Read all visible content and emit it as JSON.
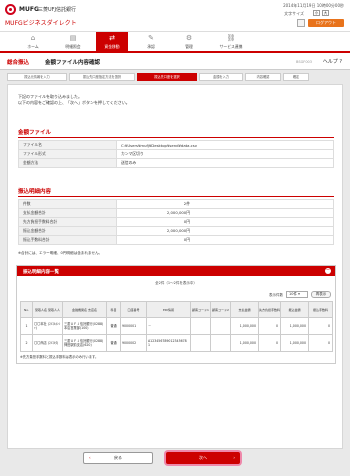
{
  "header": {
    "brand": "MUFG",
    "bank": "三菱UFJ信託銀行",
    "service": "MUFGビジネスダイレクト",
    "datetime": "2014年11月19日 10時00分00秒",
    "font_size_label": "文字サイズ",
    "font_small": "小",
    "font_large": "大",
    "logout": "ログアウト"
  },
  "gnav": [
    {
      "label": "ホーム",
      "icon": "home-icon",
      "glyph": "⌂"
    },
    {
      "label": "明細照会",
      "icon": "document-icon",
      "glyph": "▤"
    },
    {
      "label": "資金移動",
      "icon": "transfer-icon",
      "glyph": "⇄",
      "active": true
    },
    {
      "label": "承認",
      "icon": "approve-icon",
      "glyph": "✎"
    },
    {
      "label": "管理",
      "icon": "admin-icon",
      "glyph": "⚙"
    },
    {
      "label": "サービス連携",
      "icon": "link-icon",
      "glyph": "⛓"
    }
  ],
  "titlebar": {
    "category": "総合振込",
    "title": "金額ファイル内容確認",
    "page_id": "BSGF003",
    "help": "ヘルプ"
  },
  "steps": [
    "振込元情報を入力",
    "振込先口座指定方法を選択",
    "振込先口座を選択",
    "金額を入力",
    "内容確認",
    "確定"
  ],
  "active_step": 2,
  "message": [
    "下記のファイルを取り込みました。",
    "以下の内容をご確認の上、「次へ」ボタンを押してください。"
  ],
  "file_section": {
    "title": "金額ファイル",
    "rows": [
      {
        "k": "ファイル名",
        "v": "C:¥Users¥mufj¥Desktop¥send¥data.csv"
      },
      {
        "k": "ファイル形式",
        "v": "カンマ区切り"
      },
      {
        "k": "金額方法",
        "v": "送信のみ"
      }
    ]
  },
  "summary_section": {
    "title": "振込明細内容",
    "rows": [
      {
        "k": "件数",
        "v": "2件"
      },
      {
        "k": "支払金額合計",
        "v": "2,000,000円"
      },
      {
        "k": "先方負担手数料合計",
        "v": "0円"
      },
      {
        "k": "振込金額合計",
        "v": "2,000,000円"
      },
      {
        "k": "振込手数料合計",
        "v": "0円"
      }
    ],
    "note": "※合計には、エラー明細、0円明細は含まれません。"
  },
  "list": {
    "title": "振込明細内容一覧",
    "count": "全2件（1〜2件を表示中）",
    "perpage_label": "表示件数",
    "perpage_value": "10件",
    "redisplay": "再表示",
    "headers": [
      "No.",
      "受取人名 受取人人",
      "金融機関名 支店名",
      "科目",
      "口座番号",
      "EDI情報",
      "顧客コード1",
      "顧客コード2",
      "支払金額",
      "先方負担手数料",
      "振込金額",
      "振込手数料"
    ],
    "rows": [
      [
        "1",
        "〇〇本社 (ﾏﾙﾏﾙﾎﾝｼｬ)",
        "三菱ＵＦＪ信託銀行(0288) 本店営業部(100)",
        "普通",
        "9000001",
        "－",
        "",
        "",
        "1,000,000",
        "0",
        "1,000,000",
        "0"
      ],
      [
        "2",
        "〇〇商店 (ﾏﾙﾏﾙﾀ)",
        "三菱ＵＦＪ信託銀行(0288) 神田駅前支店(620)",
        "普通",
        "9000002",
        "A123456789012345678 1",
        "",
        "",
        "1,000,000",
        "0",
        "1,000,000",
        "0"
      ]
    ],
    "note": "※先方負担手数料と振込手数料は表示のみ行います。"
  },
  "buttons": {
    "back": "戻る",
    "next": "次へ"
  }
}
